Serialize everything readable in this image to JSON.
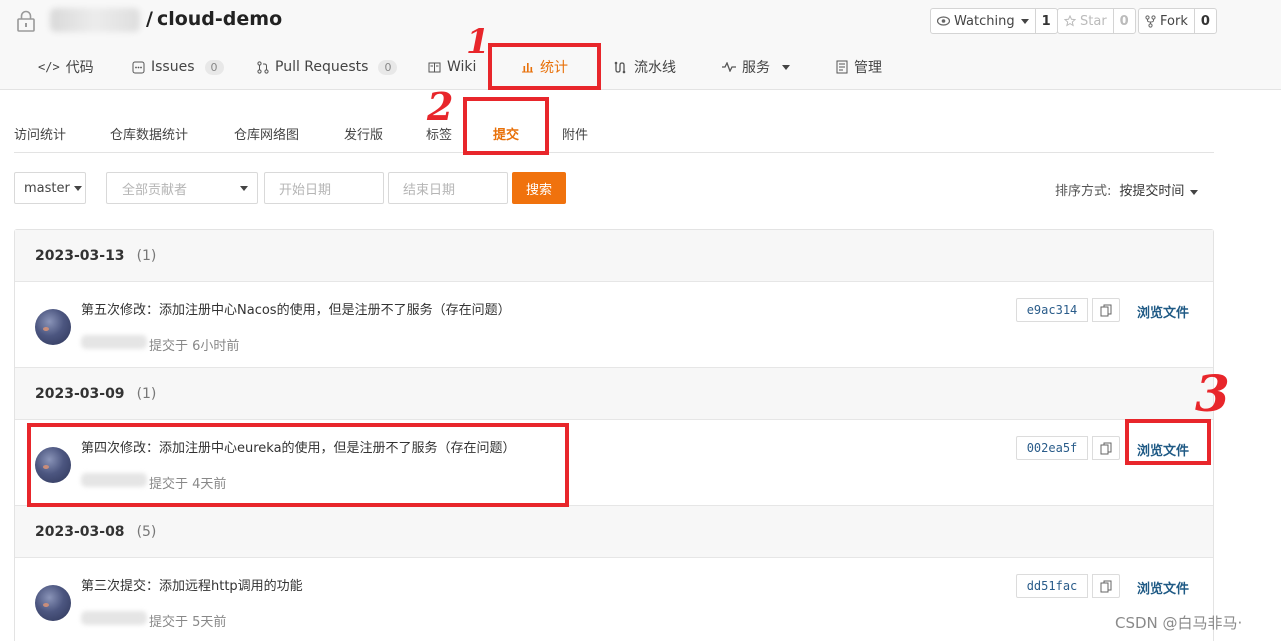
{
  "repo": {
    "name": "cloud-demo",
    "separator": "/"
  },
  "actions": {
    "watching": {
      "label": "Watching",
      "count": "1"
    },
    "star": {
      "label": "Star",
      "count": "0"
    },
    "fork": {
      "label": "Fork",
      "count": "0"
    }
  },
  "nav": {
    "code": "代码",
    "issues": "Issues",
    "issues_count": "0",
    "pull_requests": "Pull Requests",
    "pr_count": "0",
    "wiki": "Wiki",
    "stats": "统计",
    "pipeline": "流水线",
    "services": "服务",
    "manage": "管理"
  },
  "subtabs": [
    "访问统计",
    "仓库数据统计",
    "仓库网络图",
    "发行版",
    "标签",
    "提交",
    "附件"
  ],
  "filters": {
    "branch": "master",
    "contributors": "全部贡献者",
    "start_date": "开始日期",
    "end_date": "结束日期",
    "search": "搜索",
    "sort_label": "排序方式:",
    "sort_value": "按提交时间"
  },
  "days": [
    {
      "date": "2023-03-13",
      "count": "(1)"
    },
    {
      "date": "2023-03-09",
      "count": "(1)"
    },
    {
      "date": "2023-03-08",
      "count": "(5)"
    }
  ],
  "commits": [
    {
      "message": "第五次修改：添加注册中心Nacos的使用，但是注册不了服务（存在问题）",
      "time": "提交于 6小时前",
      "sha": "e9ac314",
      "browse": "浏览文件"
    },
    {
      "message": "第四次修改：添加注册中心eureka的使用，但是注册不了服务（存在问题）",
      "time": "提交于 4天前",
      "sha": "002ea5f",
      "browse": "浏览文件"
    },
    {
      "message": "第三次提交：添加远程http调用的功能",
      "time": "提交于 5天前",
      "sha": "dd51fac",
      "browse": "浏览文件"
    }
  ],
  "annotations": {
    "one": "1",
    "two": "2",
    "three": "3",
    "color": "#e8262b"
  },
  "watermark": "CSDN @白马非马·",
  "colors": {
    "accent": "#e8710a",
    "search_button": "#f0720d",
    "link": "#1f5a85"
  }
}
